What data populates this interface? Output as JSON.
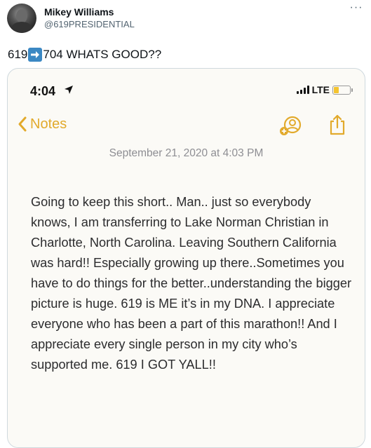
{
  "tweet": {
    "author_name": "Mikey Williams",
    "author_handle": "@619PRESIDENTIAL",
    "text_before": "619",
    "text_after": "704 WHATS GOOD??",
    "emoji": "right-arrow-emoji"
  },
  "phone": {
    "status_time": "4:04",
    "network": "LTE",
    "back_label": "Notes",
    "note_date": "September 21, 2020 at 4:03 PM",
    "note_body": "Going to keep this short.. Man.. just so everybody knows, I am transferring to Lake Norman Christian in Charlotte, North Carolina. Leaving Southern California was hard!! Especially growing up there..Sometimes you have to do things for the better..understanding the bigger picture is huge. 619 is ME it’s in my DNA. I appreciate everyone who has been a part of this marathon!! And I appreciate every single person in my city who’s supported me. 619 I GOT YALL!!",
    "accent_color": "#e2aa2c",
    "battery_color": "#f4c430"
  }
}
